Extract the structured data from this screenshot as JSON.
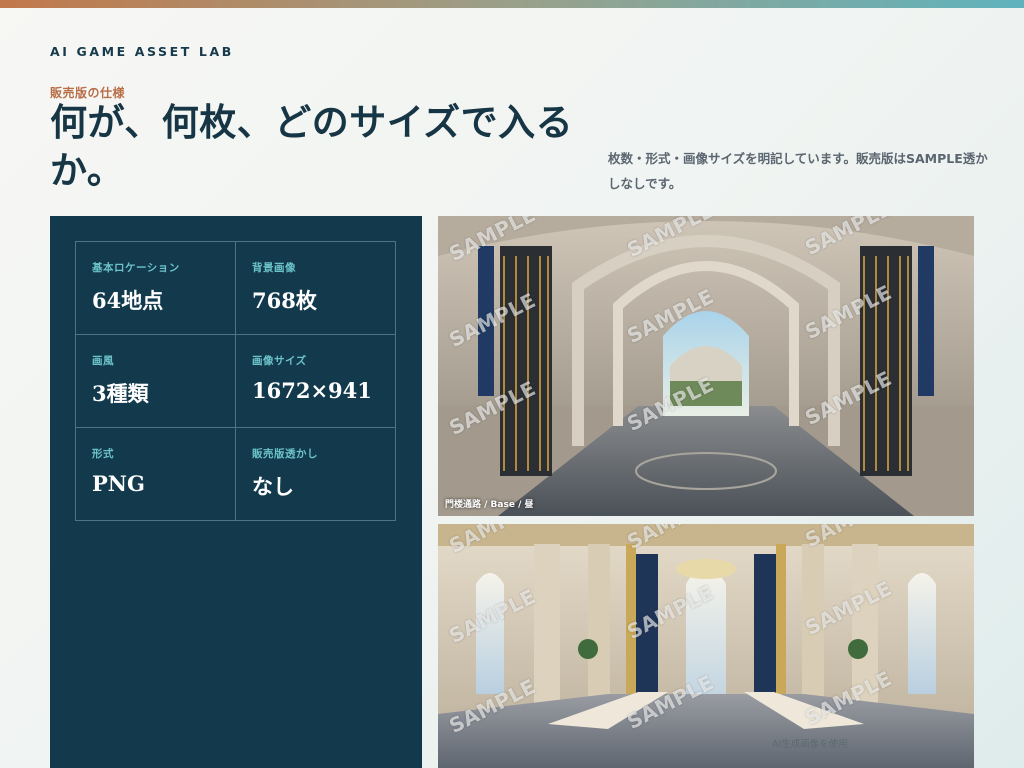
{
  "brand": "AI GAME ASSET LAB",
  "eyebrow": "販売版の仕様",
  "title": "何が、何枚、どのサイズで入るか。",
  "lead": "枚数・形式・画像サイズを明記しています。販売版はSAMPLE透かしなしです。",
  "specs": [
    {
      "label": "基本ロケーション",
      "value": "64地点"
    },
    {
      "label": "背景画像",
      "value": "768枚"
    },
    {
      "label": "画風",
      "value": "3種類"
    },
    {
      "label": "画像サイズ",
      "value": "1672×941"
    },
    {
      "label": "形式",
      "value": "PNG"
    },
    {
      "label": "販売版透かし",
      "value": "なし"
    }
  ],
  "images": {
    "watermark": "SAMPLE",
    "caption1": "門楼通路 / Base / 昼"
  },
  "credit": "AI生成画像を使用",
  "colors": {
    "accent": "#b86f48",
    "panel": "#12394c",
    "label_teal": "#6cc3c9"
  }
}
